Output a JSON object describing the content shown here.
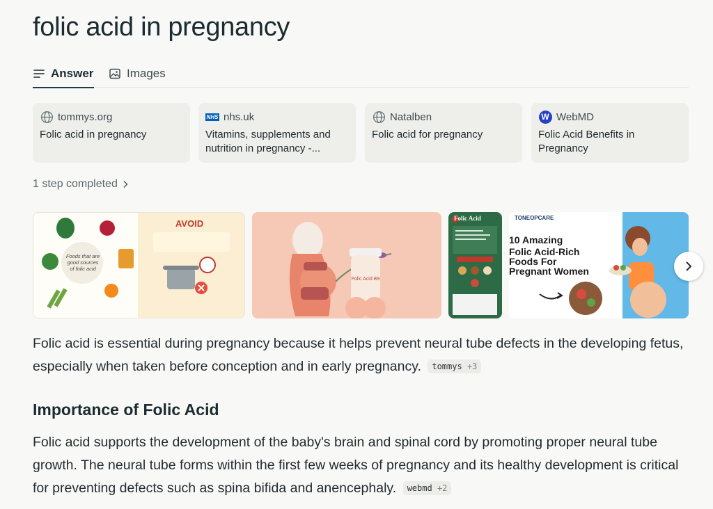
{
  "query": "folic acid in pregnancy",
  "tabs": {
    "answer": "Answer",
    "images": "Images"
  },
  "sources": [
    {
      "site": "tommys.org",
      "title": "Folic acid in pregnancy",
      "icon": "globe-icon"
    },
    {
      "site": "nhs.uk",
      "title": "Vitamins, supplements and nutrition in pregnancy -...",
      "icon": "nhs-logo-icon"
    },
    {
      "site": "Natalben",
      "title": "Folic acid for pregnancy",
      "icon": "globe-icon"
    },
    {
      "site": "WebMD",
      "title": "Folic Acid Benefits in Pregnancy",
      "icon": "webmd-logo-icon"
    }
  ],
  "steps_label": "1 step completed",
  "images": {
    "img1": {
      "left_caption": "Foods that are good sources of folic acid",
      "right_title": "AVOID"
    },
    "img2": {
      "bottle_label": "Folic Acid B9"
    },
    "img3": {
      "title": "Folic Acid"
    },
    "img4": {
      "brand": "TONEOPCARE",
      "headline_1": "10 Amazing",
      "headline_2": "Folic Acid-Rich",
      "headline_3": "Foods For",
      "headline_4": "Pregnant Women"
    }
  },
  "answer": {
    "para1": "Folic acid is essential during pregnancy because it helps prevent neural tube defects in the developing fetus, especially when taken before conception and in early pregnancy.",
    "cite1": {
      "source": "tommys",
      "more": "+3"
    },
    "heading": "Importance of Folic Acid",
    "para2": "Folic acid supports the development of the baby's brain and spinal cord by promoting proper neural tube growth. The neural tube forms within the first few weeks of pregnancy and its healthy development is critical for preventing defects such as spina bifida and anencephaly.",
    "cite2": {
      "source": "webmd",
      "more": "+2"
    }
  },
  "colors": {
    "accent": "#1b3d44",
    "background": "#f8f8f6",
    "card": "#eeeeeb"
  }
}
